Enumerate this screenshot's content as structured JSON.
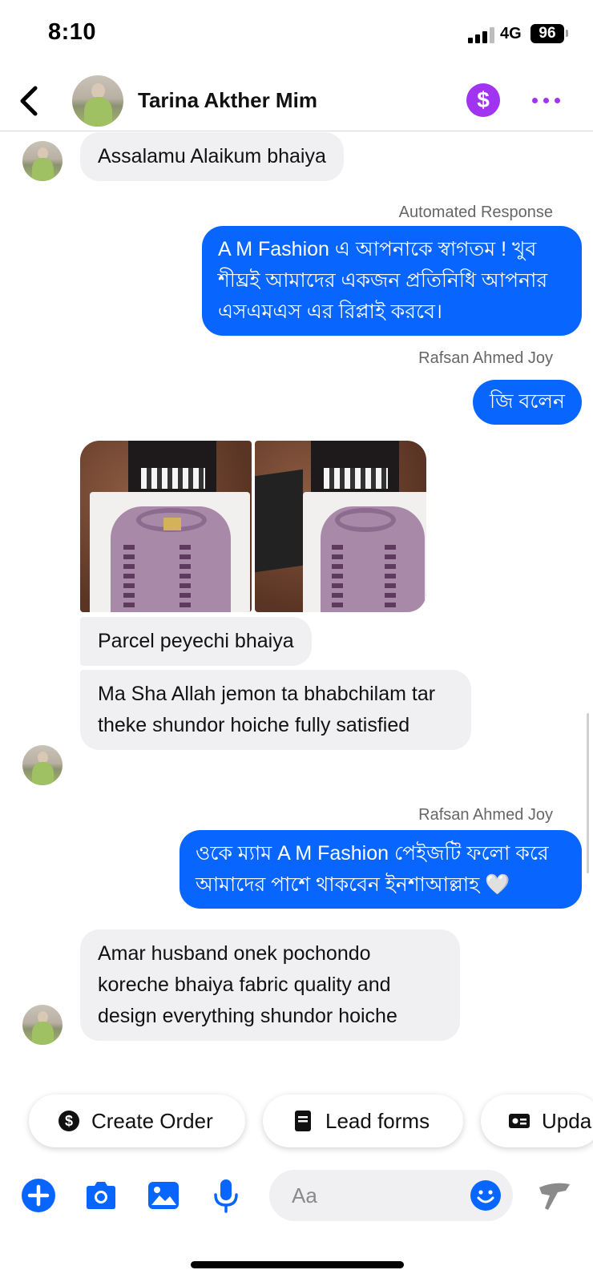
{
  "status_bar": {
    "time": "8:10",
    "network": "4G",
    "battery": "96"
  },
  "header": {
    "contact_name": "Tarina Akther Mim",
    "payment_symbol": "$"
  },
  "messages": [
    {
      "text": "Assalamu Alaikum bhaiya"
    },
    {
      "meta": "Automated Response",
      "text": "A M Fashion এ আপনাকে স্বাগতম ! খুব শীঘ্রই আমাদের একজন প্রতিনিধি আপনার এসএমএস এর রিপ্লাই করবে।"
    },
    {
      "meta": "Rafsan Ahmed Joy",
      "text": "জি বলেন"
    },
    {
      "text": "Parcel peyechi bhaiya"
    },
    {
      "text": "Ma Sha Allah jemon ta bhabchilam tar theke shundor hoiche fully satisfied"
    },
    {
      "meta": "Rafsan Ahmed Joy",
      "text": "ওকে ম্যাম A M Fashion পেইজটি ফলো করে আমাদের পাশে থাকবেন ইনশাআল্লাহ 🤍"
    },
    {
      "text": "Amar husband onek pochondo koreche bhaiya fabric quality and design everything shundor hoiche"
    }
  ],
  "quick_replies": [
    {
      "label": "Create Order",
      "icon": "dollar-circle-icon"
    },
    {
      "label": "Lead forms",
      "icon": "form-document-icon"
    },
    {
      "label": "Upda",
      "icon": "id-card-icon"
    }
  ],
  "composer": {
    "placeholder": "Aa"
  },
  "colors": {
    "outgoing": "#0866ff",
    "incoming": "#f0f0f2",
    "accent_purple": "#a034f0",
    "icon_blue": "#0866ff"
  }
}
